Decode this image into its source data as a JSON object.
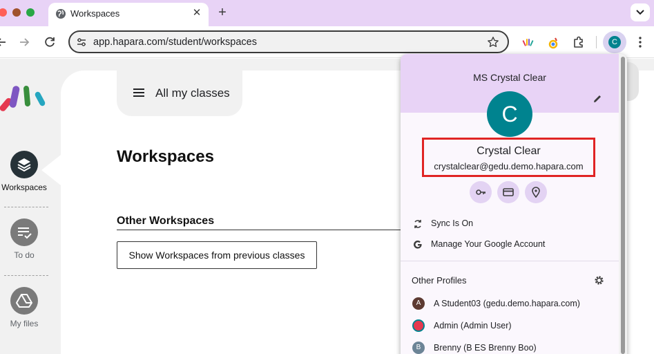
{
  "browser": {
    "tab_title": "Workspaces",
    "url": "app.hapara.com/student/workspaces",
    "profile_initial": "C"
  },
  "sidebar": {
    "items": [
      {
        "label": "Workspaces"
      },
      {
        "label": "To do"
      },
      {
        "label": "My files"
      }
    ]
  },
  "main": {
    "class_selector": "All my classes",
    "title": "Workspaces",
    "other_section": "Other Workspaces",
    "show_previous_button": "Show Workspaces from previous classes"
  },
  "profile_menu": {
    "header_title": "MS Crystal Clear",
    "avatar_initial": "C",
    "name": "Crystal Clear",
    "email": "crystalclear@gedu.demo.hapara.com",
    "sync": "Sync Is On",
    "manage": "Manage Your Google Account",
    "other_profiles_title": "Other Profiles",
    "profiles": [
      {
        "initial": "A",
        "label": "A Student03 (gedu.demo.hapara.com)",
        "color": "#5d3a32"
      },
      {
        "initial": "",
        "label": "Admin (Admin User)",
        "color": "#e53950"
      },
      {
        "initial": "B",
        "label": "Brenny (B ES Brenny Boo)",
        "color": "#6c8496"
      }
    ]
  },
  "colors": {
    "accent": "#e8d3f6",
    "avatar": "#00838f",
    "highlight_box": "#e02424"
  }
}
